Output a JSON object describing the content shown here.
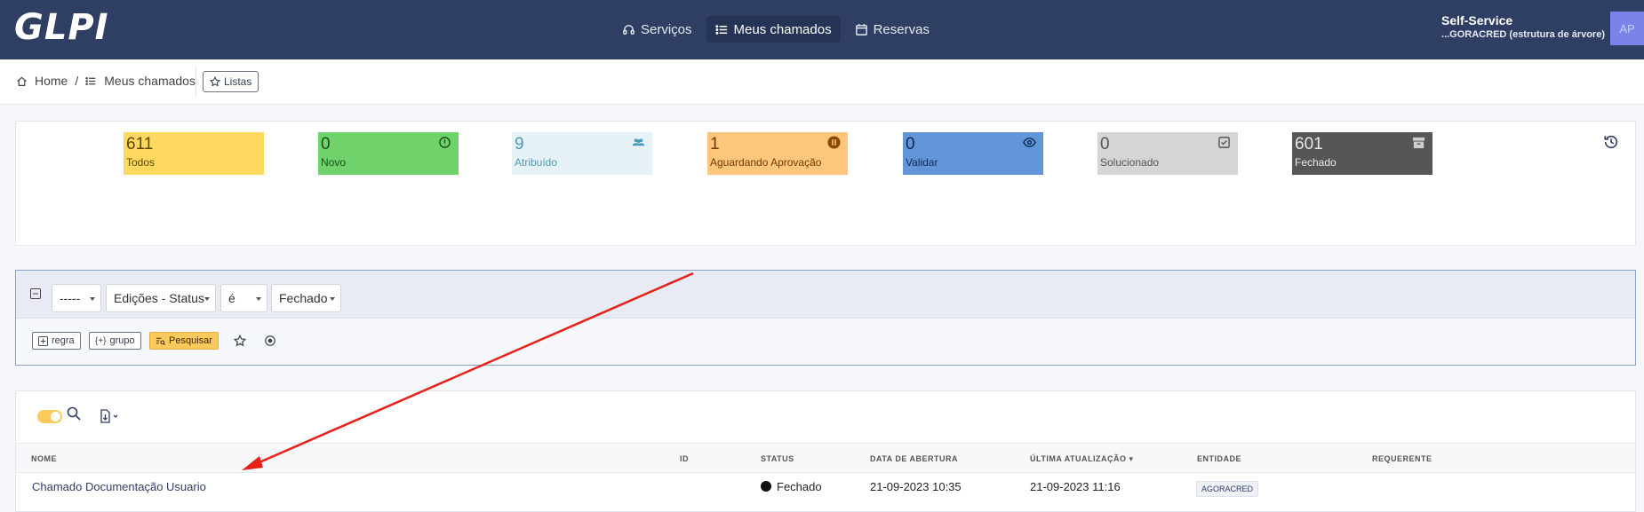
{
  "app": {
    "logo": "GLPI"
  },
  "topnav": [
    {
      "label": "Serviços",
      "icon": "headset-icon"
    },
    {
      "label": "Meus chamados",
      "icon": "list-icon",
      "active": true
    },
    {
      "label": "Reservas",
      "icon": "calendar-icon"
    }
  ],
  "user": {
    "profile": "Self-Service",
    "entity": "...GORACRED (estrutura de árvore)",
    "avatar_initials": "AP"
  },
  "breadcrumb": {
    "home": "Home",
    "sep": "/",
    "current": "Meus chamados",
    "lists_button": "Listas"
  },
  "status_tiles": [
    {
      "count": "611",
      "label": "Todos",
      "bg": "#fed85f",
      "fg": "#5a4600",
      "icon": ""
    },
    {
      "count": "0",
      "label": "Novo",
      "bg": "#70d26b",
      "fg": "#1d4d1a",
      "icon": "info-icon"
    },
    {
      "count": "9",
      "label": "Atribuído",
      "bg": "#e7f2f6",
      "fg": "#4d9bb8",
      "icon": "users-icon"
    },
    {
      "count": "1",
      "label": "Aguardando Aprovação",
      "bg": "#fdc67a",
      "fg": "#6b3f00",
      "icon": "pause-icon"
    },
    {
      "count": "0",
      "label": "Validar",
      "bg": "#6396d8",
      "fg": "#0e2a55",
      "icon": "eye-icon"
    },
    {
      "count": "0",
      "label": "Solucionado",
      "bg": "#d5d5d5",
      "fg": "#555555",
      "icon": "check-square-icon"
    },
    {
      "count": "601",
      "label": "Fechado",
      "bg": "#565656",
      "fg": "#e8e8e8",
      "icon": "archive-icon"
    }
  ],
  "criteria": {
    "link_select": "-----",
    "field_select": "Edições - Status",
    "operator_select": "é",
    "value_select": "Fechado",
    "rule_button": "regra",
    "group_button": "grupo",
    "search_button": "Pesquisar"
  },
  "table": {
    "headers": [
      "NOME",
      "ID",
      "STATUS",
      "DATA DE ABERTURA",
      "ÚLTIMA ATUALIZAÇÃO",
      "ENTIDADE",
      "REQUERENTE"
    ],
    "rows": [
      {
        "name": "Chamado Documentação Usuario",
        "id": "",
        "status": "Fechado",
        "opened": "21-09-2023 10:35",
        "updated": "21-09-2023 11:16",
        "entity": "AGORACRED",
        "requester": ""
      }
    ]
  },
  "colors": {
    "navbar": "#2f3f64",
    "accent": "#fcc95b",
    "annotation_arrow": "#e8201a"
  }
}
